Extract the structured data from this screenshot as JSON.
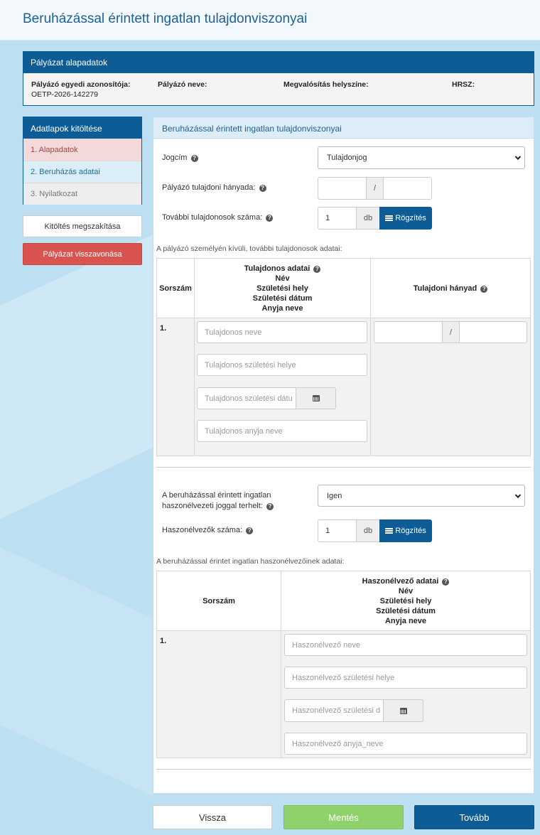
{
  "page": {
    "title": "Beruházással érintett ingatlan tulajdonviszonyai"
  },
  "basic": {
    "header": "Pályázat alapadatok",
    "fields": [
      {
        "label": "Pályázó egyedi azonosítója:",
        "value": "OETP-2026-142279"
      },
      {
        "label": "Pályázó neve:",
        "value": ""
      },
      {
        "label": "Megvalósítás helyszíne:",
        "value": ""
      },
      {
        "label": "HRSZ:",
        "value": ""
      }
    ]
  },
  "nav": {
    "header": "Adatlapok kitöltése",
    "items": [
      {
        "label": "1. Alapadatok"
      },
      {
        "label": "2. Beruházás adatai"
      },
      {
        "label": "3. Nyilatkozat"
      }
    ],
    "abort_label": "Kitöltés megszakítása",
    "withdraw_label": "Pályázat visszavonása"
  },
  "form": {
    "header": "Beruházással érintett ingatlan tulajdonviszonyai",
    "jogcim": {
      "label": "Jogcím",
      "value": "Tulajdonjog"
    },
    "hanyad": {
      "label": "Pályázó tulajdoni hányada:",
      "separator": "/"
    },
    "owners_count": {
      "label": "További tulajdonosok száma:",
      "value": "1",
      "unit": "db",
      "button": "Rögzítés"
    },
    "owners_note": "A pályázó személyén kívüli, további tulajdonosok adatai:",
    "owners_table": {
      "col_sorszam": "Sorszám",
      "col_adatai": "Tulajdonos adatai",
      "col_adatai_lines": [
        "Név",
        "Születési hely",
        "Születési dátum",
        "Anyja neve"
      ],
      "col_hanyad": "Tulajdoni hányad",
      "row_num": "1.",
      "ph_name": "Tulajdonos neve",
      "ph_birthplace": "Tulajdonos születési helye",
      "ph_birthdate": "Tulajdonos születési dátu",
      "ph_mother": "Tulajdonos anyja neve",
      "separator": "/"
    },
    "haszon": {
      "label_line1": "A beruházással érintett ingatlan",
      "label_line2": "haszonélvezeti joggal terhelt:",
      "value": "Igen"
    },
    "haszon_count": {
      "label": "Haszonélvezők száma:",
      "value": "1",
      "unit": "db",
      "button": "Rögzítés"
    },
    "haszon_note": "A beruházással érintet ingatlan haszonélvezőinek adatai:",
    "haszon_table": {
      "col_sorszam": "Sorszám",
      "col_adatai": "Haszonélvező adatai",
      "col_adatai_lines": [
        "Név",
        "Születési hely",
        "Születési dátum",
        "Anyja neve"
      ],
      "row_num": "1.",
      "ph_name": "Haszonélvező neve",
      "ph_birthplace": "Haszonélvező születési helye",
      "ph_birthdate": "Haszonélvező születési d",
      "ph_mother": "Haszonélvező anyja_neve"
    }
  },
  "footer": {
    "back": "Vissza",
    "save": "Mentés",
    "next": "Tovább"
  }
}
